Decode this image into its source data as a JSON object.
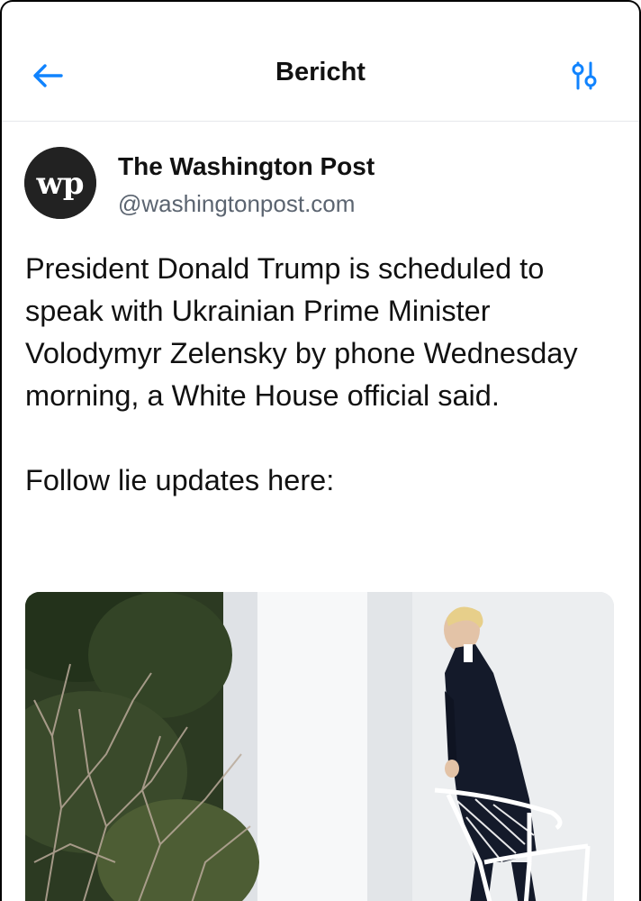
{
  "header": {
    "title": "Bericht",
    "back_icon": "arrow-left-icon",
    "settings_icon": "sliders-icon",
    "accent_color": "#1083fe"
  },
  "post": {
    "author": {
      "name": "The Washington Post",
      "handle": "@washingtonpost.com",
      "avatar_text": "wp"
    },
    "text_lines": [
      "President Donald Trump is scheduled to speak with Ukrainian Prime Minister Volodymyr Zelensky by phone Wednesday morning, a White House official said.",
      "Follow lie updates here:"
    ],
    "media": {
      "type": "photo"
    }
  }
}
